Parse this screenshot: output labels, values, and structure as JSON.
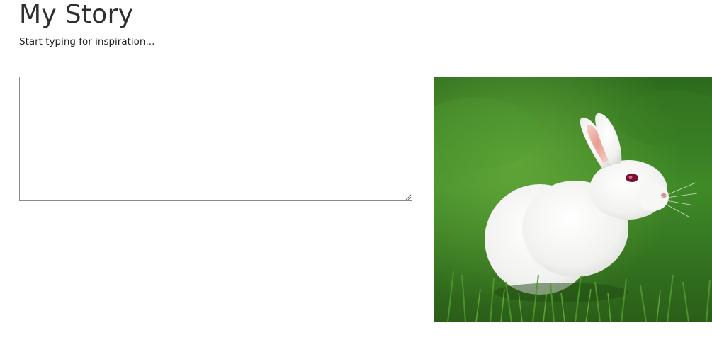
{
  "header": {
    "title": "My Story",
    "subtitle": "Start typing for inspiration..."
  },
  "story": {
    "value": "",
    "placeholder": ""
  },
  "inspiration_image": {
    "subject": "white rabbit sitting in green grass",
    "colors": {
      "grass_dark": "#2f6a1f",
      "grass_light": "#5ea33a",
      "fur": "#f4f4f2",
      "ear_inner": "#e6a79c",
      "eye": "#7a1030"
    }
  }
}
